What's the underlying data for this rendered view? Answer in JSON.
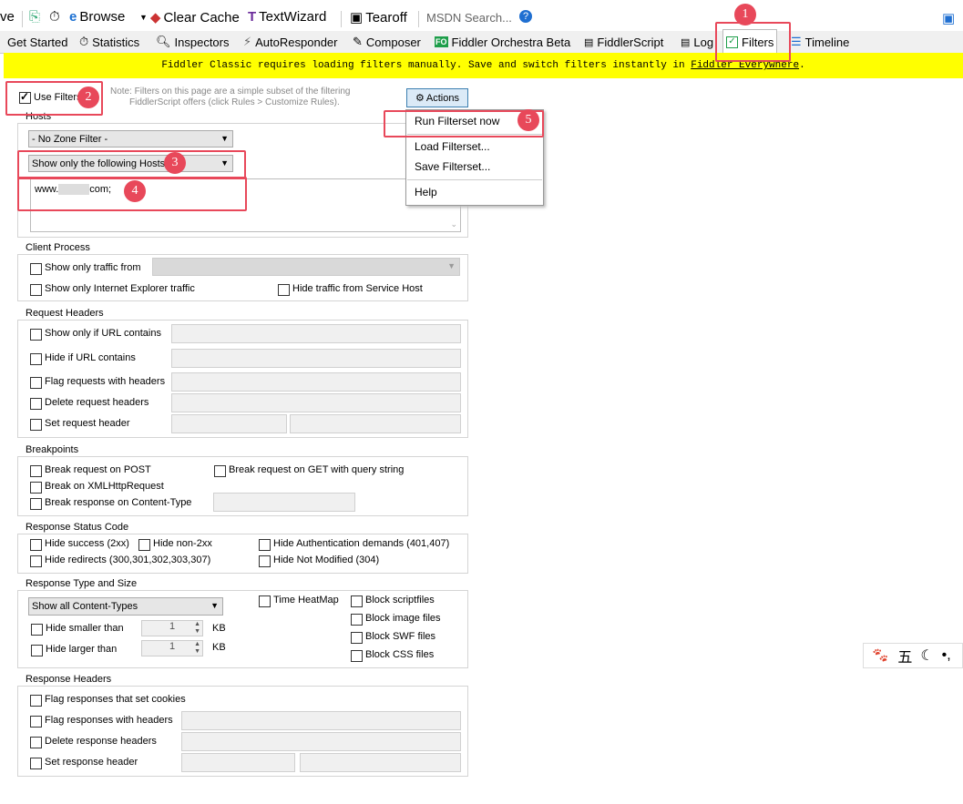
{
  "toolbar": {
    "save_partial": "ve",
    "browse": "Browse",
    "clear_cache": "Clear Cache",
    "textwizard": "TextWizard",
    "tearoff": "Tearoff",
    "msdn_search": "MSDN Search..."
  },
  "tabs": {
    "get_started": "Get Started",
    "statistics": "Statistics",
    "inspectors": "Inspectors",
    "autoresponder": "AutoResponder",
    "composer": "Composer",
    "orchestra_icon_text": "FO",
    "orchestra": "Fiddler Orchestra Beta",
    "fiddlerscript": "FiddlerScript",
    "log": "Log",
    "filters": "Filters",
    "timeline": "Timeline"
  },
  "banner": {
    "text": "Fiddler Classic requires loading filters manually. Save and switch filters instantly in ",
    "link": "Fiddler Everywhere",
    "suffix": "."
  },
  "filters": {
    "use_filters": "Use Filters",
    "note_line1": "Note: Filters on this page are a simple subset of the filtering",
    "note_line2": "FiddlerScript offers (click Rules > Customize Rules).",
    "actions_button": "Actions",
    "hosts": {
      "title": "Hosts",
      "zone_filter": "- No Zone Filter -",
      "host_filter": "Show only the following Hosts",
      "hosts_value_prefix": "www.",
      "hosts_value_suffix": "com;"
    },
    "client_process": {
      "title": "Client Process",
      "show_only_traffic_from": "Show only traffic from",
      "show_only_ie": "Show only Internet Explorer traffic",
      "hide_service_host": "Hide traffic from Service Host"
    },
    "request_headers": {
      "title": "Request Headers",
      "show_only_url": "Show only if URL contains",
      "hide_url": "Hide if URL contains",
      "flag_requests": "Flag requests with headers",
      "delete_headers": "Delete request headers",
      "set_header": "Set request header"
    },
    "breakpoints": {
      "title": "Breakpoints",
      "break_post": "Break request on POST",
      "break_get": "Break request on GET with query string",
      "break_xhr": "Break on XMLHttpRequest",
      "break_content_type": "Break response on Content-Type"
    },
    "status_code": {
      "title": "Response Status Code",
      "hide_success": "Hide success (2xx)",
      "hide_non2xx": "Hide non-2xx",
      "hide_auth": "Hide Authentication demands (401,407)",
      "hide_redirects": "Hide redirects (300,301,302,303,307)",
      "hide_not_modified": "Hide Not Modified (304)"
    },
    "type_size": {
      "title": "Response Type and Size",
      "content_types": "Show all Content-Types",
      "time_heatmap": "Time HeatMap",
      "block_script": "Block scriptfiles",
      "block_image": "Block image files",
      "block_swf": "Block SWF files",
      "block_css": "Block CSS files",
      "hide_smaller": "Hide smaller than",
      "hide_larger": "Hide larger than",
      "smaller_value": "1",
      "larger_value": "1",
      "unit": "KB"
    },
    "response_headers": {
      "title": "Response Headers",
      "flag_cookies": "Flag responses that set cookies",
      "flag_headers": "Flag responses with headers",
      "delete_headers": "Delete response headers",
      "set_header": "Set response header"
    }
  },
  "actions_menu": {
    "run": "Run Filterset now",
    "load": "Load Filterset...",
    "save": "Save Filterset...",
    "help": "Help"
  },
  "badges": [
    "1",
    "2",
    "3",
    "4",
    "5"
  ],
  "ime": {
    "five": "五"
  },
  "colors": {
    "highlight": "#e8485a",
    "banner": "#ffff00"
  }
}
